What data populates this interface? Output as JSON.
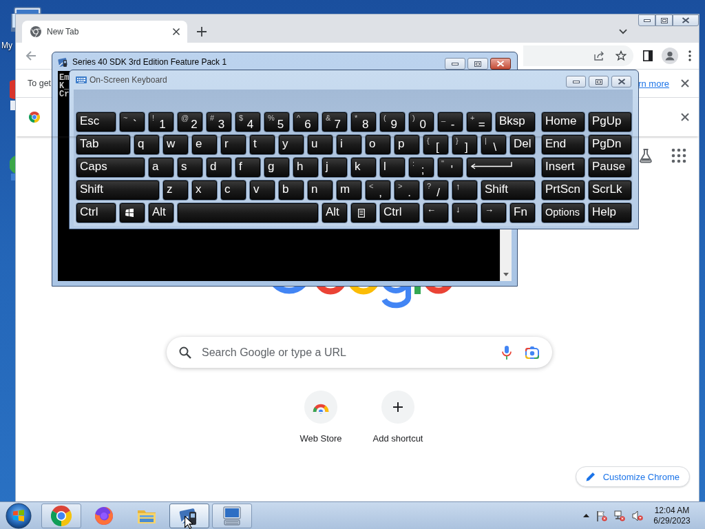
{
  "desktop": {
    "icon_labels": [
      "My"
    ]
  },
  "browser": {
    "active": false,
    "tabs": [
      {
        "title": "New Tab",
        "selected": true
      }
    ],
    "infobars": [
      {
        "kind": "message",
        "text": "To get",
        "link": "rn more"
      },
      {
        "kind": "logo"
      }
    ],
    "search": {
      "placeholder": "Search Google or type a URL"
    },
    "shortcuts": [
      {
        "kind": "store",
        "label": "Web Store"
      },
      {
        "kind": "add",
        "label": "Add shortcut"
      }
    ],
    "customize_button": "Customize Chrome"
  },
  "console_window": {
    "title": "Series 40 SDK 3rd Edition Feature Pack 1",
    "active": true,
    "lines": [
      "Em",
      "K_",
      "Cr"
    ]
  },
  "keyboard_window": {
    "title": "On-Screen Keyboard",
    "active": false,
    "rows": [
      {
        "keys": [
          {
            "kind": "text",
            "label": "Esc"
          },
          {
            "kind": "dual",
            "shift": "~",
            "label": "`"
          },
          {
            "kind": "dual",
            "shift": "!",
            "label": "1"
          },
          {
            "kind": "dual",
            "shift": "@",
            "label": "2"
          },
          {
            "kind": "dual",
            "shift": "#",
            "label": "3"
          },
          {
            "kind": "dual",
            "shift": "$",
            "label": "4"
          },
          {
            "kind": "dual",
            "shift": "%",
            "label": "5"
          },
          {
            "kind": "dual",
            "shift": "^",
            "label": "6"
          },
          {
            "kind": "dual",
            "shift": "&",
            "label": "7"
          },
          {
            "kind": "dual",
            "shift": "*",
            "label": "8"
          },
          {
            "kind": "dual",
            "shift": "(",
            "label": "9"
          },
          {
            "kind": "dual",
            "shift": ")",
            "label": "0"
          },
          {
            "kind": "dual",
            "shift": "_",
            "label": "-"
          },
          {
            "kind": "dual",
            "shift": "+",
            "label": "="
          },
          {
            "kind": "text",
            "label": "Bksp"
          }
        ]
      },
      {
        "keys": [
          {
            "kind": "text",
            "label": "Tab"
          },
          {
            "kind": "text",
            "label": "q"
          },
          {
            "kind": "text",
            "label": "w"
          },
          {
            "kind": "text",
            "label": "e"
          },
          {
            "kind": "text",
            "label": "r"
          },
          {
            "kind": "text",
            "label": "t"
          },
          {
            "kind": "text",
            "label": "y"
          },
          {
            "kind": "text",
            "label": "u"
          },
          {
            "kind": "text",
            "label": "i"
          },
          {
            "kind": "text",
            "label": "o"
          },
          {
            "kind": "text",
            "label": "p"
          },
          {
            "kind": "dual",
            "shift": "{",
            "label": "["
          },
          {
            "kind": "dual",
            "shift": "}",
            "label": "]"
          },
          {
            "kind": "dual",
            "shift": "|",
            "label": "\\"
          },
          {
            "kind": "text",
            "label": "Del"
          }
        ]
      },
      {
        "keys": [
          {
            "kind": "text",
            "label": "Caps"
          },
          {
            "kind": "text",
            "label": "a"
          },
          {
            "kind": "text",
            "label": "s"
          },
          {
            "kind": "text",
            "label": "d"
          },
          {
            "kind": "text",
            "label": "f"
          },
          {
            "kind": "text",
            "label": "g"
          },
          {
            "kind": "text",
            "label": "h"
          },
          {
            "kind": "text",
            "label": "j"
          },
          {
            "kind": "text",
            "label": "k"
          },
          {
            "kind": "text",
            "label": "l"
          },
          {
            "kind": "dual",
            "shift": ":",
            "label": ";"
          },
          {
            "kind": "dual",
            "shift": "\"",
            "label": "'"
          },
          {
            "kind": "enter"
          }
        ]
      },
      {
        "keys": [
          {
            "kind": "text",
            "label": "Shift"
          },
          {
            "kind": "text",
            "label": "z"
          },
          {
            "kind": "text",
            "label": "x"
          },
          {
            "kind": "text",
            "label": "c"
          },
          {
            "kind": "text",
            "label": "v"
          },
          {
            "kind": "text",
            "label": "b"
          },
          {
            "kind": "text",
            "label": "n"
          },
          {
            "kind": "text",
            "label": "m"
          },
          {
            "kind": "dual",
            "shift": "<",
            "label": ","
          },
          {
            "kind": "dual",
            "shift": ">",
            "label": "."
          },
          {
            "kind": "dual",
            "shift": "?",
            "label": "/"
          },
          {
            "kind": "arrow",
            "label": "↑"
          },
          {
            "kind": "text",
            "label": "Shift"
          }
        ]
      },
      {
        "keys": [
          {
            "kind": "text",
            "label": "Ctrl"
          },
          {
            "kind": "windows"
          },
          {
            "kind": "text",
            "label": "Alt"
          },
          {
            "kind": "space"
          },
          {
            "kind": "text",
            "label": "Alt"
          },
          {
            "kind": "menu"
          },
          {
            "kind": "text",
            "label": "Ctrl"
          },
          {
            "kind": "arrow",
            "label": "←"
          },
          {
            "kind": "arrow",
            "label": "↓"
          },
          {
            "kind": "arrow",
            "label": "→"
          },
          {
            "kind": "text",
            "label": "Fn"
          }
        ]
      }
    ],
    "side_rows": [
      {
        "keys": [
          "Home",
          "PgUp"
        ]
      },
      {
        "keys": [
          "End",
          "PgDn"
        ]
      },
      {
        "keys": [
          "Insert",
          "Pause"
        ]
      },
      {
        "keys": [
          "PrtScn",
          "ScrLk"
        ]
      },
      {
        "keys": [
          "Options",
          "Help"
        ]
      }
    ]
  },
  "taskbar": {
    "items": [
      {
        "kind": "browser",
        "running": true,
        "selected": false
      },
      {
        "kind": "fox",
        "running": false,
        "selected": false
      },
      {
        "kind": "folder",
        "running": false,
        "selected": false
      },
      {
        "kind": "phone",
        "running": true,
        "selected": true
      },
      {
        "kind": "keyboard",
        "running": true,
        "selected": false
      }
    ],
    "clock": {
      "time": "12:04 AM",
      "date": "6/29/2023"
    }
  }
}
